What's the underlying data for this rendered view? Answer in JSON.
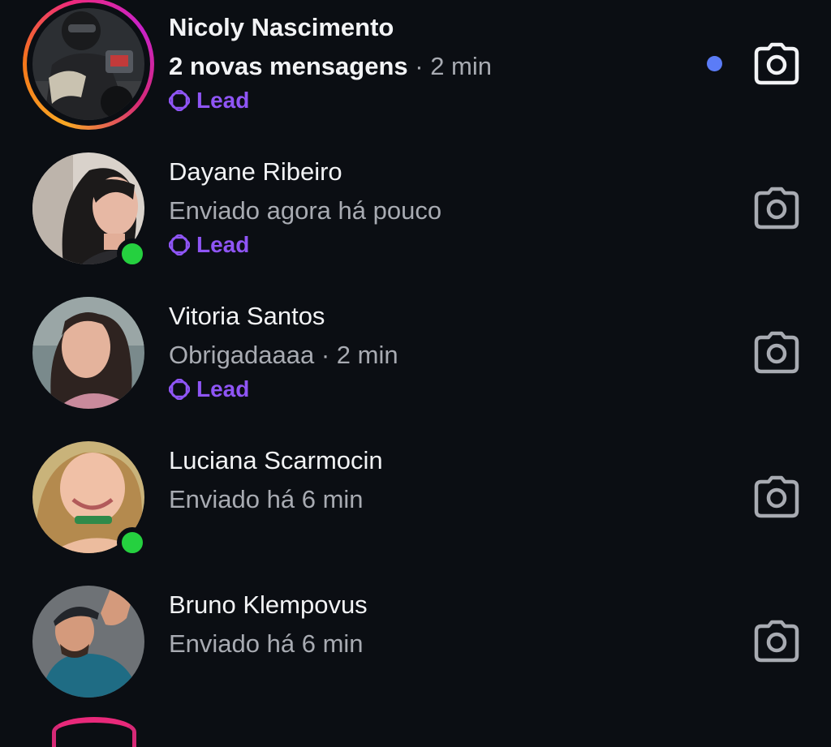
{
  "threads": [
    {
      "name": "Nicoly Nascimento",
      "subtitle_strong": "2 novas mensagens",
      "subtitle_rest": " · 2 min",
      "tag": "Lead",
      "has_story": true,
      "unread": true,
      "online": false,
      "action_icon": "camera-icon"
    },
    {
      "name": "Dayane Ribeiro",
      "subtitle": "Enviado agora há pouco",
      "tag": "Lead",
      "has_story": false,
      "unread": false,
      "online": true,
      "action_icon": "camera-icon"
    },
    {
      "name": "Vitoria Santos",
      "subtitle": "Obrigadaaaa · 2 min",
      "tag": "Lead",
      "has_story": false,
      "unread": false,
      "online": false,
      "action_icon": "camera-icon"
    },
    {
      "name": "Luciana Scarmocin",
      "subtitle": "Enviado há 6 min",
      "has_story": false,
      "unread": false,
      "online": true,
      "action_icon": "camera-icon"
    },
    {
      "name": "Bruno Klempovus",
      "subtitle": "Enviado há 6 min",
      "has_story": false,
      "unread": false,
      "online": false,
      "action_icon": "camera-icon"
    }
  ],
  "colors": {
    "background": "#0b0e13",
    "lead_tag": "#8f55f5",
    "unread_dot": "#5b7cf7",
    "online_dot": "#25d03f"
  }
}
